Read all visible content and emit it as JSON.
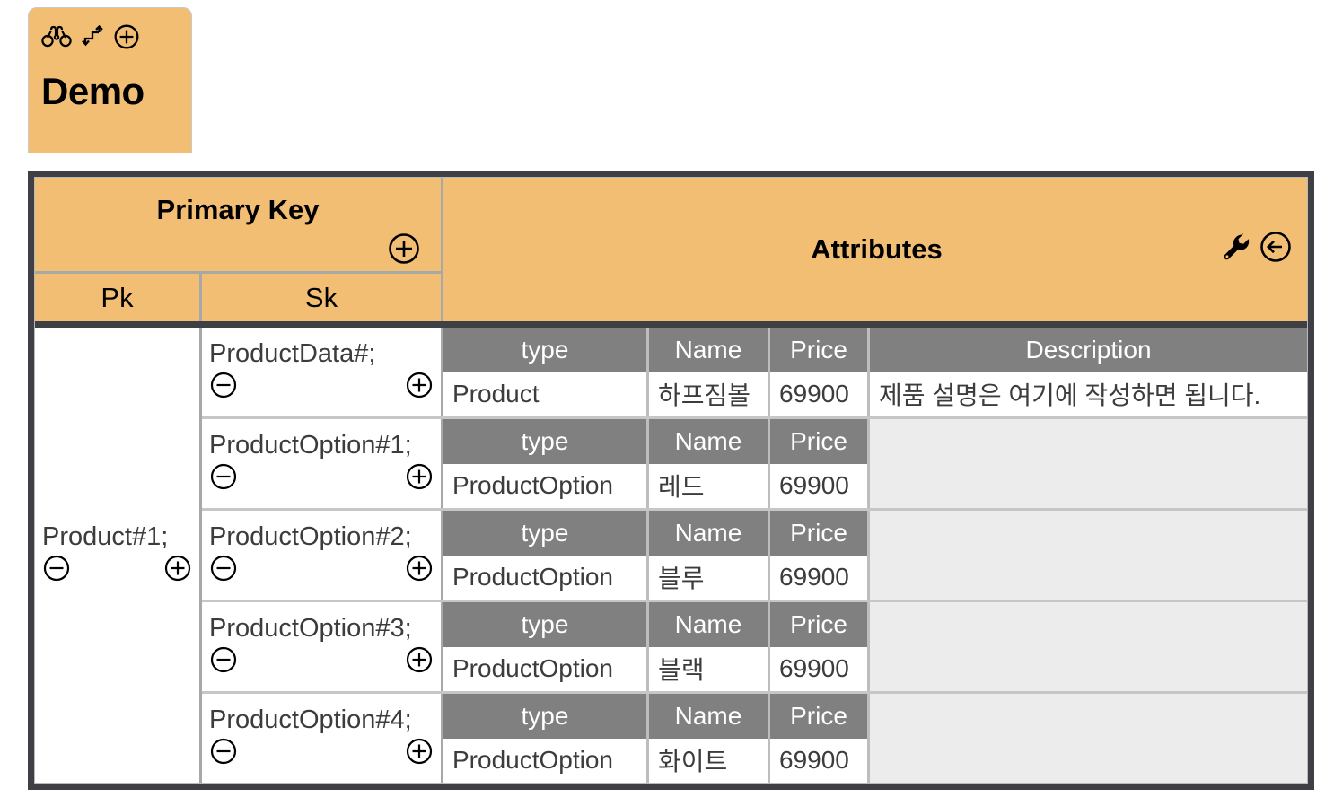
{
  "tab": {
    "title": "Demo",
    "icons": [
      "binoculars-icon",
      "swap-arrows-icon",
      "plus-circle-icon"
    ]
  },
  "header": {
    "primary_key": {
      "title": "Primary Key",
      "add_icon": "plus-circle-icon",
      "sub_columns": [
        "Pk",
        "Sk"
      ]
    },
    "attributes": {
      "title": "Attributes",
      "tool_icons": [
        "wrench-icon",
        "back-arrow-circle-icon"
      ]
    }
  },
  "partition": {
    "pk_label": "Product#1;",
    "remove_icon": "minus-circle-icon",
    "add_icon": "plus-circle-icon"
  },
  "columns": {
    "type": "type",
    "name": "Name",
    "price": "Price",
    "description": "Description"
  },
  "rows": [
    {
      "sk": "ProductData#;",
      "type": "Product",
      "name": "하프짐볼",
      "price": "69900",
      "description": "제품 설명은 여기에 작성하면 됩니다.",
      "has_description": true
    },
    {
      "sk": "ProductOption#1;",
      "type": "ProductOption",
      "name": "레드",
      "price": "69900",
      "description": "",
      "has_description": false
    },
    {
      "sk": "ProductOption#2;",
      "type": "ProductOption",
      "name": "블루",
      "price": "69900",
      "description": "",
      "has_description": false
    },
    {
      "sk": "ProductOption#3;",
      "type": "ProductOption",
      "name": "블랙",
      "price": "69900",
      "description": "",
      "has_description": false
    },
    {
      "sk": "ProductOption#4;",
      "type": "ProductOption",
      "name": "화이트",
      "price": "69900",
      "description": "",
      "has_description": false
    }
  ],
  "colors": {
    "tab_background": "#F2BE74",
    "header_background": "#F2BE74",
    "table_border": "#3F3F46",
    "column_header_background": "#808080",
    "empty_cell_background": "#ECECEC",
    "text": "#3C3C3C"
  }
}
